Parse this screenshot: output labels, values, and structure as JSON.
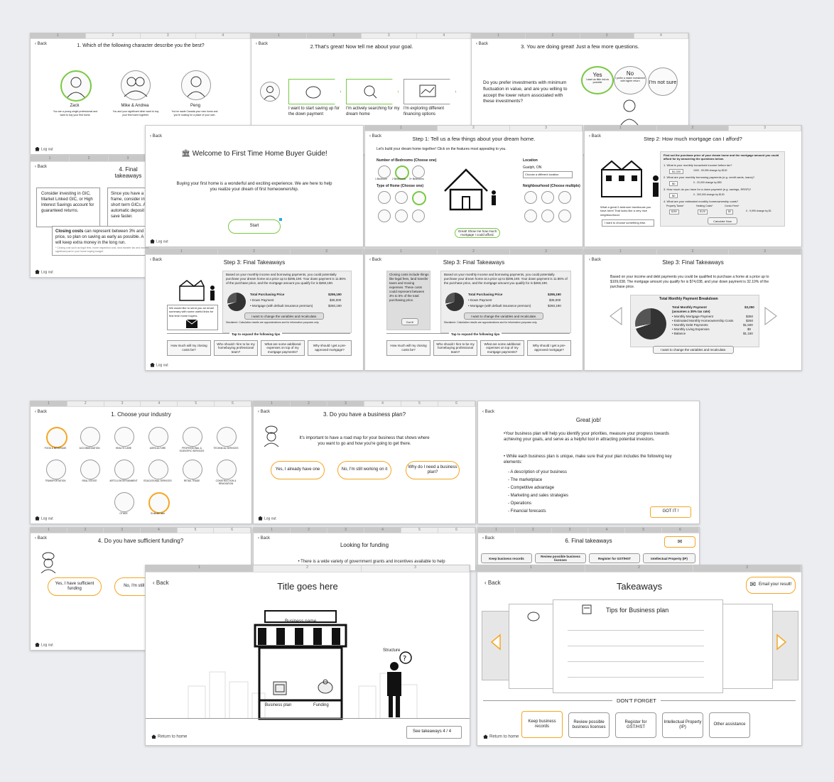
{
  "common": {
    "back": "Back",
    "logout": "Log out",
    "return_home": "Return to home"
  },
  "home": {
    "q1": {
      "title": "1. Which of the following character describe you the best?",
      "options": [
        {
          "name": "Zack",
          "desc": "You are a young single professional and want to buy your first home."
        },
        {
          "name": "Mike & Andrea",
          "desc": "You and your significant other want to buy your first home together."
        },
        {
          "name": "Peng",
          "desc": "You've made Canada your new home and you're looking for a place of your own."
        }
      ]
    },
    "q2": {
      "title": "2.That's great! Now tell me about your goal.",
      "options": [
        "I want to start saving up for the down payment",
        "I'm actively searching for my dream home",
        "I'm exploring different financing options"
      ]
    },
    "q3": {
      "title": "3. You are doing great! Just a few more questions.",
      "question": "Do you prefer investments with minimum fluctuation in value, and are you willing to accept the lower return associated with these investments?",
      "yes": "Yes",
      "yes_sub": "I want as little risk as possible",
      "no": "No",
      "no_sub": "I prefer a riskier investment with higher return",
      "notsure": "I'm not sure"
    },
    "q4": {
      "title": "4. Final takeaways",
      "card1": "Consider investing in GIC, Market Linked GIC, or High Interest Savings account for guaranteed returns.",
      "card2": "Since you have a short time frame, consider investing in short term GICs. Also set up automatic deposit to help you save faster.",
      "closing_bold": "Closing costs",
      "closing_rest": " can represent between 3% and 4% of the purchase price, so plan on saving as early as possible. A solid down payment will keep extra money in the long run.",
      "footnote": "* Closing cost such as legal fees, home inspection cost, land transfer tax and moving expenses could play a significant part in your home buying budget."
    },
    "welcome": {
      "title": "Welcome to First Time Home Buyer Guide!",
      "body": "Buying your first home is a wonderful and exciting experience. We are here to help you realize your dream of first homeownership.",
      "start": "Start"
    },
    "step1": {
      "title": "Step 1: Tell us a few things about your dream home.",
      "intro": "Let's build your dream home together! Click on the features most appealing to you.",
      "bedrooms_label": "Number of Bedrooms (Choose one)",
      "bedrooms": [
        "1 Bedroom",
        "2 Bedrooms",
        "3+ Bedrooms"
      ],
      "type_label": "Type of Home (Choose one)",
      "types": [
        "Detached",
        "Semi-Detached",
        "Townhouse",
        "Duplex",
        "Condo Apartments",
        "Other"
      ],
      "location_label": "Location",
      "location_value": "Guelph, ON",
      "location_select": "Choose a different location",
      "neigh_label": "Neighbourhood (Choose multiple)",
      "neighs": [
        "Restaurants/ Bars",
        "Trails/ Parks",
        "Shopping Centre",
        "Public Transit",
        "School District",
        "No Preference"
      ],
      "cta": "Great! Show me how much mortgage I could afford."
    },
    "step2": {
      "title": "Step 2: How much mortgage can I afford?",
      "panel_title": "Find out the purchase price of your dream home and the mortgage amount you could afford for by answering the questions below.",
      "q1": "1. What is your monthly household income before tax?",
      "q1v": "$1,000",
      "q1h": "1000 - 99,999 change by $100",
      "q2": "2. What are your monthly borrowing payments (e.g. credit cards, loans)?",
      "q2v": "$0",
      "q2h": "0 - 20,000 change by $50",
      "q3": "3. How much do you have for a down payment (e.g. savings, RRSP)?",
      "q3v": "$0",
      "q3h": "0 - 300,000 change by $100",
      "q4": "4. What are your estimated monthly homeownership costs?",
      "q4a": "Property Taxes*",
      "q4b": "Heating Costs*",
      "q4c": "Condo Fees*",
      "q4av": "$250",
      "q4bv": "$125",
      "q4cv": "$0",
      "q4h": "0 - 9,999 change by $1",
      "calc": "Calculate Now",
      "caption": "What a great 2-bedroom townhouse you have here! That looks like a very nice neighbourhood.",
      "choose_else": "I want to choose something else."
    },
    "step3a": {
      "title": "Step 3: Final Takeaways",
      "summary": "Based on your monthly income and borrowing payments, you could potentially purchase your dream home at a price up to $295,190. Your down payment is 11.86% of the purchase price, and the mortgage amount you qualify for is $260,190.",
      "tpp": "Total Purchasing Price",
      "tpp_v": "$295,190",
      "dp": "• Down Payment",
      "dp_v": "$35,000",
      "mort": "• Mortgage (with default insurance premium)",
      "mort_v": "$260,190",
      "change": "I want to change the variables and recalculate.",
      "disclaimer": "Disclaimer: Calculation results are approximations and for information purposes only.",
      "email_note": "We would like to send you an email summary with some useful links for first time home buyers.",
      "tips_label": "Tap to expand the following tips",
      "tips": [
        "How much will my closing costs be?",
        "Who should I hire to be my homebuying professional team?",
        "What are some additional expenses on top of my mortgage payments?",
        "Why should I get a pre-approved mortgage?"
      ],
      "closing_pop": "Closing costs include things like legal fees, land transfer taxes and moving expenses. These costs could represent between 3% to 5% of the total purchasing price.",
      "got_it": "Got it!"
    },
    "step3c": {
      "title": "Step 3: Final Takeaways",
      "summary": "Based on your income and debt payments you could be qualified to purchase a home at a price up to $109,038. The mortgage amount you qualify for is $74,038, and your down payment is 32.10% of the purchase price.",
      "table_title": "Total Monthly Payment Breakdown",
      "tmp": "Total Monthly Payment",
      "tmp_sub": "(assumes a 35% tax rate)",
      "tmp_v": "$3,250",
      "rows": [
        [
          "• Monthly Mortgage Payment",
          "$350"
        ],
        [
          "• Estimated Monthly Homeownership Costs",
          "$250"
        ],
        [
          "• Monthly Debt Payments",
          "$1,500"
        ],
        [
          "• Monthly Living Expenses",
          "$0"
        ],
        [
          "• Balance",
          "$1,150"
        ]
      ],
      "change": "I want to change the variables and recalculate."
    }
  },
  "biz": {
    "industry": {
      "title": "1. Choose your industry",
      "items": [
        "FOOD & BEVERAGE",
        "ACCOMMODATION",
        "HEALTH CARE",
        "AGRICULTURE",
        "PROFESSIONAL & SCIENTIFIC SERVICES",
        "TECHNICAL SERVICES",
        "TRANSPORTATION",
        "REAL ESTATE",
        "ARTS & ENTERTAINMENT",
        "EDUCATIONAL SERVICES",
        "RETAIL TRADE",
        "CONSTRUCTION & RENOVATION",
        "OTHER",
        "I'll decide later"
      ],
      "icon": "icon"
    },
    "plan": {
      "title": "3. Do you have a business plan?",
      "body": "It's important to have a road map for your business that shows where you want to go and how you're going to get there.",
      "opts": [
        "Yes, I already have one",
        "No, I'm still working on it",
        "Why do I need a business plan?"
      ]
    },
    "great": {
      "title": "Great job!",
      "p1": "•Your business plan will help you identify your priorities, measure your progress towards achieving your goals, and serve as a helpful tool in attracting potential investors.",
      "p2": "• While each business plan is unique, make sure that your plan includes the following key elements:",
      "elements": [
        "- A description of your business",
        "- The marketplace",
        "- Competitive advantage",
        "- Marketing and sales strategies",
        "- Operations",
        "- Financial forecasts"
      ],
      "got_it": "GOT IT !"
    },
    "funding": {
      "title": "4. Do you have sufficient funding?",
      "opts": [
        "Yes, I have sufficient funding",
        "No, I'm still looking"
      ]
    },
    "looking": {
      "title": "Looking for funding",
      "body": "• There is a wide variety of government grants and incentives available to help"
    },
    "final6": {
      "title": "6. Final takeaways",
      "tabs": [
        "Keep business records",
        "Review possible business licenses",
        "Register for GST/HST",
        "Intellectual Property (IP)"
      ]
    },
    "title_here": {
      "title": "Title goes here",
      "business_name": "Business name",
      "plan": "Business plan",
      "funding": "Funding",
      "structure": "Structure",
      "see": "See takeaways 4 / 4"
    },
    "takeaways": {
      "title": "Takeaways",
      "email": "Email your result!",
      "tips": "Tips for Business plan",
      "dont_forget": "DON'T FORGET",
      "items": [
        "Keep business records",
        "Review possible business licenses",
        "Register for GST/HST",
        "Intellectual Property (IP)",
        "Other assistance"
      ]
    }
  }
}
